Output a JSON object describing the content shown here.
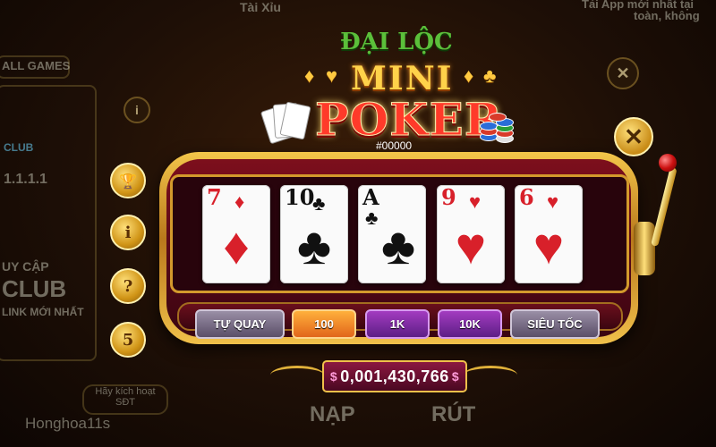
{
  "background": {
    "top_center_text": "Tài Xỉu",
    "top_right_text_1": "Tải App mới nhất tại",
    "top_right_text_2": "toàn, không",
    "all_games": "ALL GAMES",
    "left_number": "1.1.1.1",
    "left_club_top": "CLUB",
    "left_club_big": "CLUB",
    "left_truy_cap": "UY CẬP",
    "left_link": "LINK MỚI NHẤT",
    "activate_button": "Hãy kích hoạt SĐT",
    "username": "Honghoa11s",
    "nap_label": "NẠP",
    "rut_label": "RÚT"
  },
  "title": {
    "dailoc": "ĐẠI LỘC",
    "mini": "MINI",
    "poker": "POKER",
    "session": "#00000"
  },
  "cards": [
    {
      "rank": "7",
      "suit": "♦",
      "color": "red"
    },
    {
      "rank": "10",
      "suit": "♣",
      "color": "black"
    },
    {
      "rank": "A",
      "suit": "♣",
      "color": "black"
    },
    {
      "rank": "9",
      "suit": "♥",
      "color": "red"
    },
    {
      "rank": "6",
      "suit": "♥",
      "color": "red"
    }
  ],
  "buttons": {
    "auto_spin": "TỰ QUAY",
    "bet_100": "100",
    "bet_1k": "1K",
    "bet_10k": "10K",
    "turbo": "SIÊU TỐC"
  },
  "jackpot": {
    "currency": "$",
    "value": "0,001,430,766"
  },
  "side_buttons": {
    "trophy": "🏆",
    "info": "i",
    "help": "?",
    "history": "5"
  },
  "close_label": "✕",
  "colors": {
    "machine_red": "#7d0f1c",
    "gold": "#f0c04a",
    "bet_active": "#e1651a",
    "bet_purple": "#5d1f86"
  }
}
